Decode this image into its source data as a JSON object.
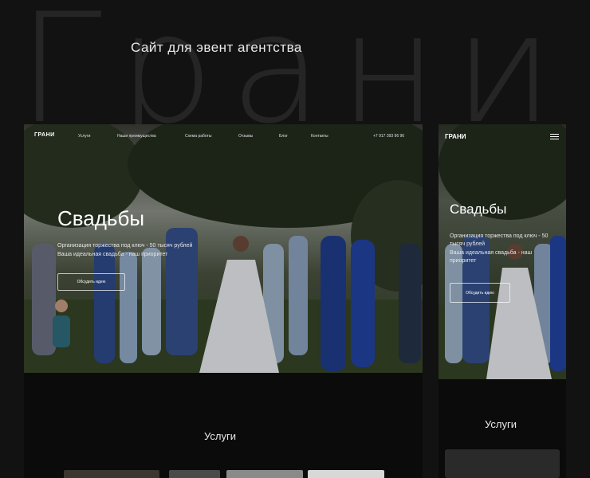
{
  "background_word": "Грани",
  "header": {
    "title": "Сайт для эвент агентства"
  },
  "desktop": {
    "nav": {
      "logo": "ГРАНИ",
      "items": [
        "Услуги",
        "Наши преимущества",
        "Схема работы",
        "Отзывы",
        "Блог",
        "Контакты"
      ],
      "phone": "+7 917 393 96 96"
    },
    "hero": {
      "title": "Свадьбы",
      "lines": [
        "Организация торжества под ключ - 50 тысяч рублей",
        "Ваша идеальная свадьба - наш приоритет"
      ],
      "button": "Обсудить идею"
    },
    "services_title": "Услуги"
  },
  "mobile": {
    "nav": {
      "logo": "ГРАНИ",
      "menu_icon": "burger-menu-icon"
    },
    "hero": {
      "title": "Свадьбы",
      "lines": [
        "Организация торжества под ключ - 50",
        "тысяч рублей",
        "Ваша идеальная свадьба - наш",
        "приоритет"
      ],
      "button": "Обсудить идею"
    },
    "services_title": "Услуги"
  },
  "colors": {
    "background": "#121212",
    "panel": "#0b0b0b",
    "text": "#e8e8e8",
    "ghost_text": "#252525"
  }
}
